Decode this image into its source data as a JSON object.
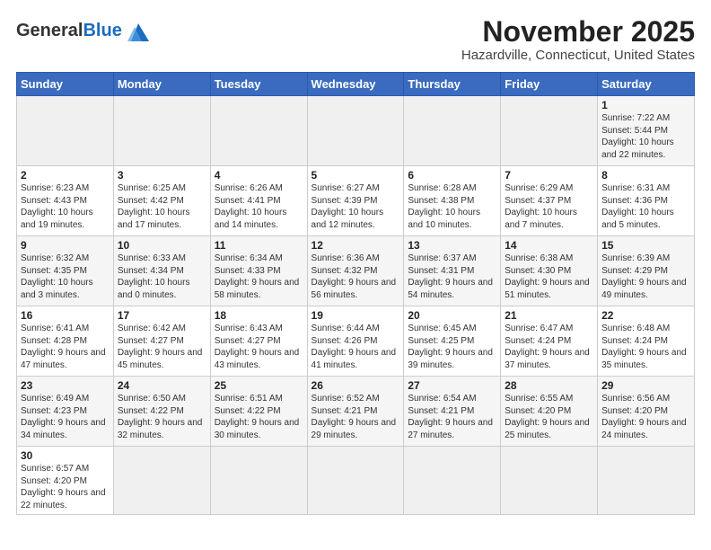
{
  "header": {
    "logo_general": "General",
    "logo_blue": "Blue",
    "title": "November 2025",
    "subtitle": "Hazardville, Connecticut, United States"
  },
  "weekdays": [
    "Sunday",
    "Monday",
    "Tuesday",
    "Wednesday",
    "Thursday",
    "Friday",
    "Saturday"
  ],
  "rows": [
    {
      "cells": [
        {
          "day": "",
          "info": "",
          "empty": true
        },
        {
          "day": "",
          "info": "",
          "empty": true
        },
        {
          "day": "",
          "info": "",
          "empty": true
        },
        {
          "day": "",
          "info": "",
          "empty": true
        },
        {
          "day": "",
          "info": "",
          "empty": true
        },
        {
          "day": "",
          "info": "",
          "empty": true
        },
        {
          "day": "1",
          "info": "Sunrise: 7:22 AM\nSunset: 5:44 PM\nDaylight: 10 hours\nand 22 minutes."
        }
      ],
      "shade": "gray"
    },
    {
      "cells": [
        {
          "day": "2",
          "info": "Sunrise: 6:23 AM\nSunset: 4:43 PM\nDaylight: 10 hours\nand 19 minutes."
        },
        {
          "day": "3",
          "info": "Sunrise: 6:25 AM\nSunset: 4:42 PM\nDaylight: 10 hours\nand 17 minutes."
        },
        {
          "day": "4",
          "info": "Sunrise: 6:26 AM\nSunset: 4:41 PM\nDaylight: 10 hours\nand 14 minutes."
        },
        {
          "day": "5",
          "info": "Sunrise: 6:27 AM\nSunset: 4:39 PM\nDaylight: 10 hours\nand 12 minutes."
        },
        {
          "day": "6",
          "info": "Sunrise: 6:28 AM\nSunset: 4:38 PM\nDaylight: 10 hours\nand 10 minutes."
        },
        {
          "day": "7",
          "info": "Sunrise: 6:29 AM\nSunset: 4:37 PM\nDaylight: 10 hours\nand 7 minutes."
        },
        {
          "day": "8",
          "info": "Sunrise: 6:31 AM\nSunset: 4:36 PM\nDaylight: 10 hours\nand 5 minutes."
        }
      ],
      "shade": "white"
    },
    {
      "cells": [
        {
          "day": "9",
          "info": "Sunrise: 6:32 AM\nSunset: 4:35 PM\nDaylight: 10 hours\nand 3 minutes."
        },
        {
          "day": "10",
          "info": "Sunrise: 6:33 AM\nSunset: 4:34 PM\nDaylight: 10 hours\nand 0 minutes."
        },
        {
          "day": "11",
          "info": "Sunrise: 6:34 AM\nSunset: 4:33 PM\nDaylight: 9 hours\nand 58 minutes."
        },
        {
          "day": "12",
          "info": "Sunrise: 6:36 AM\nSunset: 4:32 PM\nDaylight: 9 hours\nand 56 minutes."
        },
        {
          "day": "13",
          "info": "Sunrise: 6:37 AM\nSunset: 4:31 PM\nDaylight: 9 hours\nand 54 minutes."
        },
        {
          "day": "14",
          "info": "Sunrise: 6:38 AM\nSunset: 4:30 PM\nDaylight: 9 hours\nand 51 minutes."
        },
        {
          "day": "15",
          "info": "Sunrise: 6:39 AM\nSunset: 4:29 PM\nDaylight: 9 hours\nand 49 minutes."
        }
      ],
      "shade": "gray"
    },
    {
      "cells": [
        {
          "day": "16",
          "info": "Sunrise: 6:41 AM\nSunset: 4:28 PM\nDaylight: 9 hours\nand 47 minutes."
        },
        {
          "day": "17",
          "info": "Sunrise: 6:42 AM\nSunset: 4:27 PM\nDaylight: 9 hours\nand 45 minutes."
        },
        {
          "day": "18",
          "info": "Sunrise: 6:43 AM\nSunset: 4:27 PM\nDaylight: 9 hours\nand 43 minutes."
        },
        {
          "day": "19",
          "info": "Sunrise: 6:44 AM\nSunset: 4:26 PM\nDaylight: 9 hours\nand 41 minutes."
        },
        {
          "day": "20",
          "info": "Sunrise: 6:45 AM\nSunset: 4:25 PM\nDaylight: 9 hours\nand 39 minutes."
        },
        {
          "day": "21",
          "info": "Sunrise: 6:47 AM\nSunset: 4:24 PM\nDaylight: 9 hours\nand 37 minutes."
        },
        {
          "day": "22",
          "info": "Sunrise: 6:48 AM\nSunset: 4:24 PM\nDaylight: 9 hours\nand 35 minutes."
        }
      ],
      "shade": "white"
    },
    {
      "cells": [
        {
          "day": "23",
          "info": "Sunrise: 6:49 AM\nSunset: 4:23 PM\nDaylight: 9 hours\nand 34 minutes."
        },
        {
          "day": "24",
          "info": "Sunrise: 6:50 AM\nSunset: 4:22 PM\nDaylight: 9 hours\nand 32 minutes."
        },
        {
          "day": "25",
          "info": "Sunrise: 6:51 AM\nSunset: 4:22 PM\nDaylight: 9 hours\nand 30 minutes."
        },
        {
          "day": "26",
          "info": "Sunrise: 6:52 AM\nSunset: 4:21 PM\nDaylight: 9 hours\nand 29 minutes."
        },
        {
          "day": "27",
          "info": "Sunrise: 6:54 AM\nSunset: 4:21 PM\nDaylight: 9 hours\nand 27 minutes."
        },
        {
          "day": "28",
          "info": "Sunrise: 6:55 AM\nSunset: 4:20 PM\nDaylight: 9 hours\nand 25 minutes."
        },
        {
          "day": "29",
          "info": "Sunrise: 6:56 AM\nSunset: 4:20 PM\nDaylight: 9 hours\nand 24 minutes."
        }
      ],
      "shade": "gray"
    },
    {
      "cells": [
        {
          "day": "30",
          "info": "Sunrise: 6:57 AM\nSunset: 4:20 PM\nDaylight: 9 hours\nand 22 minutes."
        },
        {
          "day": "",
          "info": "",
          "empty": true
        },
        {
          "day": "",
          "info": "",
          "empty": true
        },
        {
          "day": "",
          "info": "",
          "empty": true
        },
        {
          "day": "",
          "info": "",
          "empty": true
        },
        {
          "day": "",
          "info": "",
          "empty": true
        },
        {
          "day": "",
          "info": "",
          "empty": true
        }
      ],
      "shade": "white"
    }
  ]
}
